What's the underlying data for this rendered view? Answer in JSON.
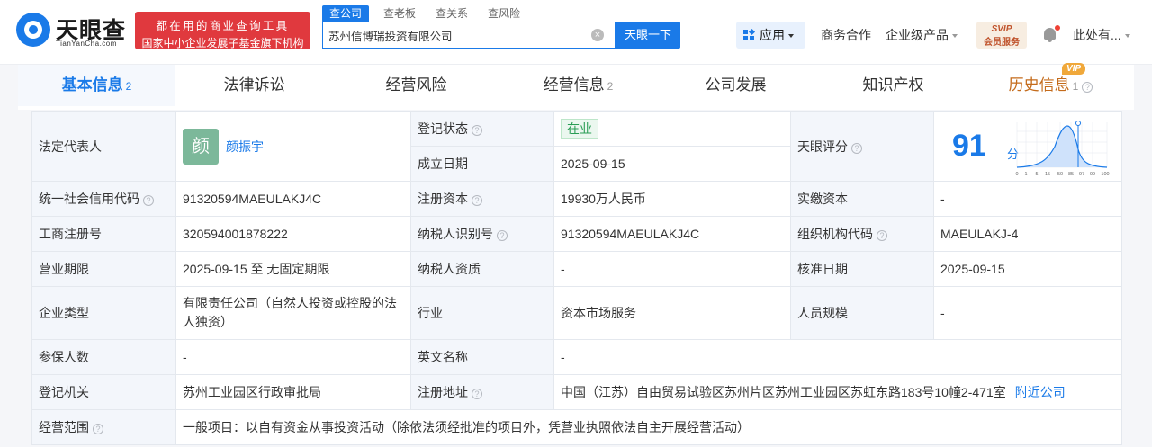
{
  "header": {
    "logo_cn": "天眼查",
    "logo_en": "TianYanCha.com",
    "slogan_line1": "都在用的商业查询工具",
    "slogan_line2": "国家中小企业发展子基金旗下机构",
    "search_tabs": [
      "查公司",
      "查老板",
      "查关系",
      "查风险"
    ],
    "search_value": "苏州信博瑞投资有限公司",
    "search_button": "天眼一下",
    "nav_app": "应用",
    "nav_business": "商务合作",
    "nav_enterprise": "企业级产品",
    "svip_line1": "SVIP",
    "svip_line2": "会员服务",
    "user_name": "此处有..."
  },
  "tabs": {
    "basic": "基本信息",
    "basic_count": "2",
    "legal": "法律诉讼",
    "risk": "经营风险",
    "operation": "经营信息",
    "operation_count": "2",
    "development": "公司发展",
    "ip": "知识产权",
    "history": "历史信息",
    "history_count": "1",
    "vip_badge": "VIP"
  },
  "info": {
    "legal_rep_label": "法定代表人",
    "legal_rep_avatar": "颜",
    "legal_rep_name": "颜振宇",
    "reg_status_label": "登记状态",
    "reg_status_value": "在业",
    "found_date_label": "成立日期",
    "found_date_value": "2025-09-15",
    "score_label": "天眼评分",
    "score_value": "91",
    "score_unit": "分",
    "score_axis": [
      "0",
      "1",
      "5",
      "15",
      "50",
      "85",
      "97",
      "99",
      "100"
    ],
    "credit_code_label": "统一社会信用代码",
    "credit_code_value": "91320594MAEULAKJ4C",
    "reg_capital_label": "注册资本",
    "reg_capital_value": "19930万人民币",
    "paid_capital_label": "实缴资本",
    "paid_capital_value": "-",
    "biz_reg_label": "工商注册号",
    "biz_reg_value": "320594001878222",
    "taxpayer_id_label": "纳税人识别号",
    "taxpayer_id_value": "91320594MAEULAKJ4C",
    "org_code_label": "组织机构代码",
    "org_code_value": "MAEULAKJ-4",
    "term_label": "营业期限",
    "term_value": "2025-09-15 至 无固定期限",
    "tax_qual_label": "纳税人资质",
    "tax_qual_value": "-",
    "approve_date_label": "核准日期",
    "approve_date_value": "2025-09-15",
    "type_label": "企业类型",
    "type_value": "有限责任公司（自然人投资或控股的法人独资）",
    "industry_label": "行业",
    "industry_value": "资本市场服务",
    "staff_label": "人员规模",
    "staff_value": "-",
    "insured_label": "参保人数",
    "insured_value": "-",
    "en_name_label": "英文名称",
    "en_name_value": "-",
    "authority_label": "登记机关",
    "authority_value": "苏州工业园区行政审批局",
    "address_label": "注册地址",
    "address_value": "中国（江苏）自由贸易试验区苏州片区苏州工业园区苏虹东路183号10幢2-471室",
    "nearby_link": "附近公司",
    "scope_label": "经营范围",
    "scope_value": "一般项目：以自有资金从事投资活动（除依法须经批准的项目外，凭营业执照依法自主开展经营活动）"
  }
}
